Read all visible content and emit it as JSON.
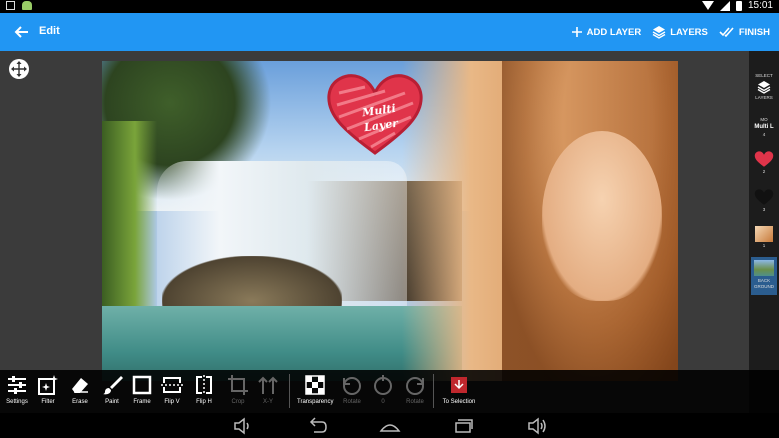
{
  "statusbar": {
    "time": "15:01"
  },
  "actionbar": {
    "title": "Edit",
    "add_layer": "ADD LAYER",
    "layers": "LAYERS",
    "finish": "FINISH"
  },
  "canvas": {
    "heart_line1": "Multi",
    "heart_line2": "Layer"
  },
  "layers": {
    "select_label": "SELECT",
    "layers_label": "LAYERS",
    "items": [
      {
        "top": "MO",
        "label": "Multi L",
        "num": "4"
      },
      {
        "num": "2"
      },
      {
        "num": "3"
      },
      {
        "num": "1"
      },
      {
        "label": "BACK GROUND"
      }
    ]
  },
  "toolbar": {
    "settings": "Settings",
    "filter": "Filter",
    "erase": "Erase",
    "paint": "Paint",
    "frame": "Frame",
    "flip_v": "Flip V",
    "flip_h": "Flip H",
    "crop": "Crop",
    "xy": "X-Y",
    "transparency": "Transparency",
    "rotate": "Rotate",
    "zero": "0",
    "rotate2": "Rotate",
    "to_selection": "To Selection"
  },
  "colors": {
    "action_bar": "#2196f3",
    "heart": "#e0344a",
    "selected_layer": "#2b5d8f"
  },
  "icons": {
    "back": "arrow-left-icon",
    "add": "plus-icon",
    "layers": "layers-icon",
    "finish": "double-check-icon",
    "move": "move-arrows-icon"
  }
}
